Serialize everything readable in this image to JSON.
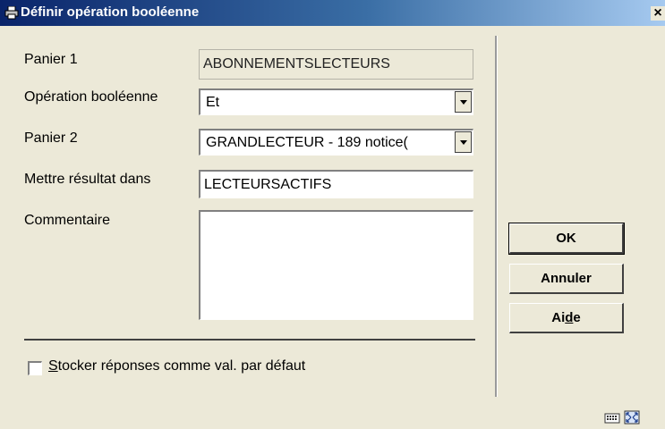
{
  "window": {
    "title": "Définir opération booléenne",
    "close_label": "×"
  },
  "form": {
    "panier1": {
      "label": "Panier 1",
      "value": "ABONNEMENTSLECTEURS"
    },
    "operation": {
      "label": "Opération booléenne",
      "value": "Et"
    },
    "panier2": {
      "label": "Panier 2",
      "value": "GRANDLECTEUR - 189 notice("
    },
    "resultat": {
      "label": "Mettre résultat dans",
      "value": "LECTEURSACTIFS"
    },
    "commentaire": {
      "label": "Commentaire",
      "value": ""
    },
    "stocker": {
      "label_prefix": "S",
      "label_rest": "tocker réponses comme val. par défaut",
      "checked": false
    }
  },
  "buttons": {
    "ok": "OK",
    "annuler": "Annuler",
    "aide_prefix": "Ai",
    "aide_mnemonic": "d",
    "aide_suffix": "e"
  },
  "icons": {
    "title": "printer-icon",
    "status_left": "keyboard-icon",
    "status_right": "resize-icon"
  }
}
